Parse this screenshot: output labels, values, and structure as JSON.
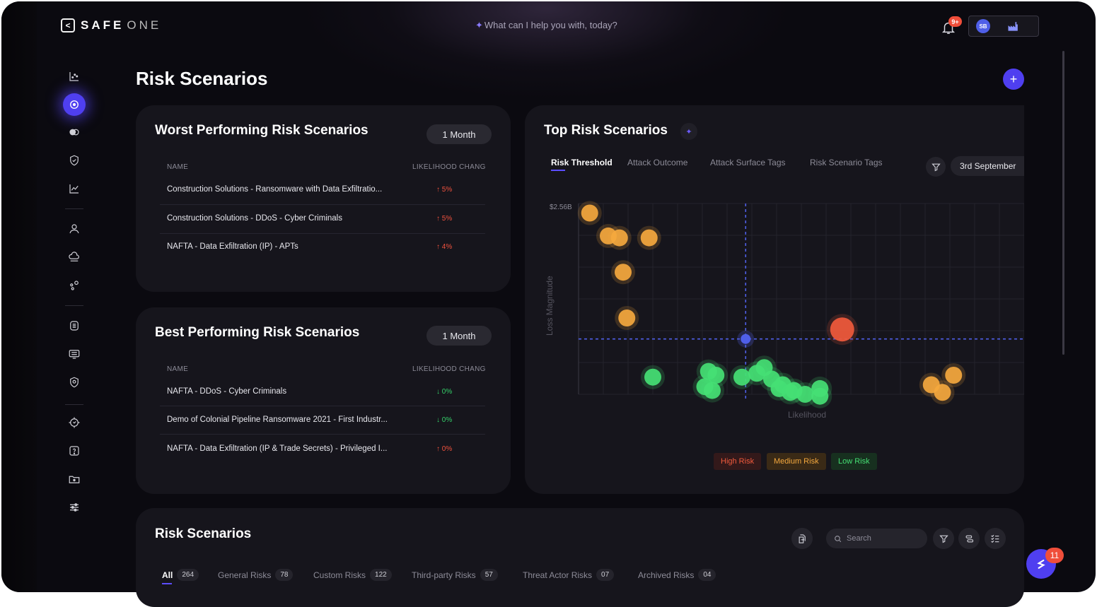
{
  "app": {
    "logo_bold": "SAFE",
    "logo_light": "ONE",
    "assistant_placeholder": "What can I help you with, today?",
    "notifications_badge": "9+",
    "avatar_initials": "SB"
  },
  "sidebar": {
    "icons": [
      "scatter-chart-icon",
      "target-icon",
      "toggle-circles-icon",
      "shield-check-icon",
      "line-chart-icon",
      "user-icon",
      "cloud-icon",
      "nodes-icon",
      "database-icon",
      "server-list-icon",
      "shield-search-icon",
      "settings-gear-icon",
      "help-icon",
      "folder-icon",
      "sliders-icon"
    ]
  },
  "page": {
    "title": "Risk Scenarios",
    "add_label": "+"
  },
  "worst": {
    "title": "Worst Performing Risk Scenarios",
    "period": "1 Month",
    "col_name": "NAME",
    "col_change": "LIKELIHOOD CHANG",
    "rows": [
      {
        "name": "Construction Solutions - Ransomware with Data Exfiltratio...",
        "change": "↑ 5%",
        "dir": "up"
      },
      {
        "name": "Construction Solutions - DDoS - Cyber Criminals",
        "change": "↑ 5%",
        "dir": "up"
      },
      {
        "name": "NAFTA - Data Exfiltration (IP) - APTs",
        "change": "↑ 4%",
        "dir": "up"
      }
    ]
  },
  "best": {
    "title": "Best Performing Risk Scenarios",
    "period": "1 Month",
    "col_name": "NAME",
    "col_change": "LIKELIHOOD CHANG",
    "rows": [
      {
        "name": "NAFTA - DDoS - Cyber Criminals",
        "change": "↓ 0%",
        "dir": "down"
      },
      {
        "name": "Demo of Colonial Pipeline Ransomware 2021 - First Industr...",
        "change": "↓ 0%",
        "dir": "down"
      },
      {
        "name": "NAFTA - Data Exfiltration (IP & Trade Secrets) - Privileged I...",
        "change": "↑ 0%",
        "dir": "up"
      }
    ]
  },
  "top": {
    "title": "Top Risk Scenarios",
    "tabs": [
      "Risk Threshold",
      "Attack Outcome",
      "Attack Surface Tags",
      "Risk Scenario Tags"
    ],
    "date": "3rd September",
    "legend": {
      "high": "High Risk",
      "medium": "Medium Risk",
      "low": "Low Risk"
    },
    "colors": {
      "high": "#f05a3c",
      "medium": "#f4a83e",
      "low": "#45df74",
      "threshold": "#4f5fe8"
    }
  },
  "chart_data": {
    "type": "scatter",
    "xlabel": "Likelihood",
    "ylabel": "Loss Magnitude",
    "y_top_tick": "$2.56B",
    "threshold": {
      "x": 0.45,
      "y": 0.29
    },
    "series": [
      {
        "name": "High Risk",
        "points": [
          [
            0.71,
            0.34
          ]
        ]
      },
      {
        "name": "Medium Risk",
        "points": [
          [
            0.03,
            0.95
          ],
          [
            0.08,
            0.83
          ],
          [
            0.11,
            0.82
          ],
          [
            0.19,
            0.82
          ],
          [
            0.12,
            0.64
          ],
          [
            0.13,
            0.4
          ],
          [
            0.95,
            0.05
          ],
          [
            0.98,
            0.01
          ],
          [
            1.01,
            0.1
          ]
        ]
      },
      {
        "name": "Low Risk",
        "points": [
          [
            0.2,
            0.09
          ],
          [
            0.35,
            0.12
          ],
          [
            0.37,
            0.1
          ],
          [
            0.34,
            0.04
          ],
          [
            0.36,
            0.02
          ],
          [
            0.44,
            0.09
          ],
          [
            0.48,
            0.11
          ],
          [
            0.5,
            0.14
          ],
          [
            0.52,
            0.08
          ],
          [
            0.55,
            0.05
          ],
          [
            0.54,
            0.03
          ],
          [
            0.57,
            0.01
          ],
          [
            0.58,
            0.02
          ],
          [
            0.61,
            0.0
          ],
          [
            0.65,
            0.03
          ],
          [
            0.65,
            -0.01
          ]
        ]
      }
    ]
  },
  "scenarios": {
    "title": "Risk Scenarios",
    "search_placeholder": "Search",
    "tabs": [
      {
        "label": "All",
        "count": "264"
      },
      {
        "label": "General Risks",
        "count": "78"
      },
      {
        "label": "Custom Risks",
        "count": "122"
      },
      {
        "label": "Third-party Risks",
        "count": "57"
      },
      {
        "label": "Threat Actor Risks",
        "count": "07"
      },
      {
        "label": "Archived Risks",
        "count": "04"
      }
    ]
  },
  "chat": {
    "badge": "11"
  }
}
